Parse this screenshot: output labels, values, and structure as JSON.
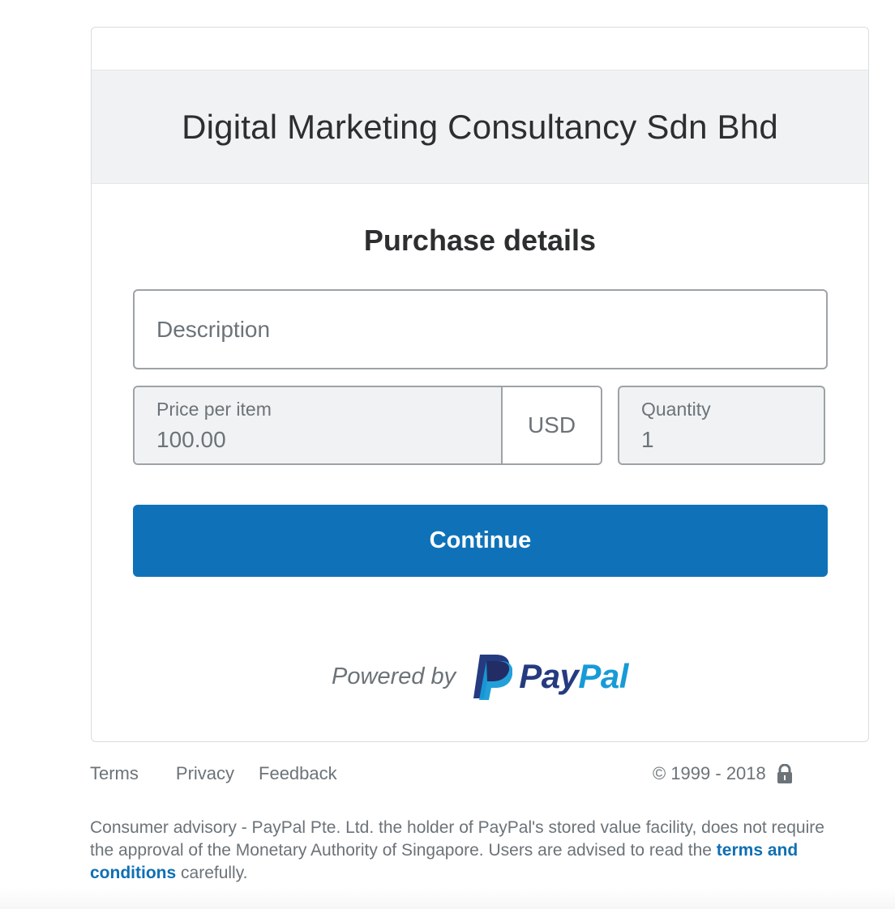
{
  "merchant": {
    "name": "Digital Marketing Consultancy Sdn Bhd"
  },
  "purchase": {
    "title": "Purchase details",
    "description_placeholder": "Description",
    "description_value": "",
    "price_label": "Price per item",
    "price_value": "100.00",
    "currency": "USD",
    "quantity_label": "Quantity",
    "quantity_value": "1",
    "continue_label": "Continue"
  },
  "powered_by": {
    "text": "Powered by",
    "brand_pay": "Pay",
    "brand_pal": "Pal",
    "brand_colors": {
      "pay": "#253b80",
      "pal": "#179bd7"
    }
  },
  "footer": {
    "links": [
      "Terms",
      "Privacy",
      "Feedback"
    ],
    "copyright": "© 1999 - 2018",
    "lock_icon": "lock-icon",
    "advisory_text": "Consumer advisory - PayPal Pte. Ltd. the holder of PayPal's stored value facility, does not require the approval of the Monetary Authority of Singapore. Users are advised to read the",
    "advisory_link": "terms and conditions",
    "advisory_suffix": "carefully."
  },
  "colors": {
    "accent": "#0f72b8",
    "link": "#0f6fb3",
    "field_border": "#9da3a6",
    "muted_text": "#6c7378"
  }
}
